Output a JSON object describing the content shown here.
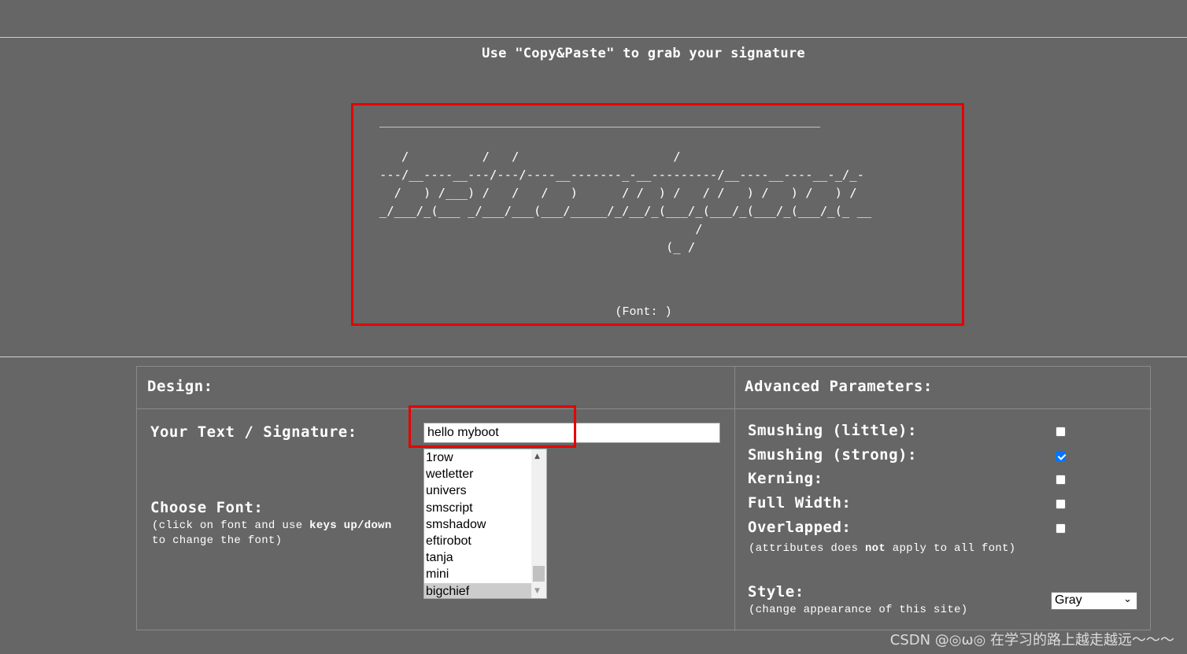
{
  "header": {
    "instruction": "Use \"Copy&Paste\" to grab your signature"
  },
  "output": {
    "ascii_lines": [
      "____________________________________________________________",
      "",
      "   /          /   /                     /",
      "---/__----__---/---/----__-------_-__---------/__----__----__-_/_-",
      "  /   ) /___) /   /   /   )      / /  ) /   / /   ) /   ) /   ) /",
      "_/___/_(___ _/___/___(___/_____/_/__/_(___/_(___/_(___/_(___/_(_ __",
      "                                           /",
      "                                       (_ /"
    ],
    "font_caption": "(Font: )"
  },
  "design": {
    "heading": "Design:",
    "text_label": "Your Text / Signature:",
    "text_value": "hello myboot",
    "font_label": "Choose Font:",
    "font_hint_pre": "(click on font and use ",
    "font_hint_keys": "keys up/down",
    "font_hint_line2": "to change the font)",
    "fonts": [
      "1row",
      "wetletter",
      "univers",
      "smscript",
      "smshadow",
      "eftirobot",
      "tanja",
      "mini",
      "bigchief"
    ],
    "selected_font": "bigchief",
    "scroll_up_icon": "▲",
    "scroll_down_icon": "▼"
  },
  "advanced": {
    "heading": "Advanced Parameters:",
    "params": [
      {
        "label": "Smushing (little):",
        "checked": false
      },
      {
        "label": "Smushing (strong):",
        "checked": true
      },
      {
        "label": "Kerning:",
        "checked": false
      },
      {
        "label": "Full Width:",
        "checked": false
      },
      {
        "label": "Overlapped:",
        "checked": false
      }
    ],
    "note_pre": "(attributes does ",
    "note_bold": "not",
    "note_post": " apply to all font)",
    "style_label": "Style:",
    "style_hint": "(change appearance of this site)",
    "style_value": "Gray",
    "style_chevron": "⌄"
  },
  "watermark": "CSDN @◎ω◎ 在学习的路上越走越远～～～",
  "colors": {
    "background": "#666666",
    "highlight": "#e60000",
    "checkbox_checked": "#0075ff"
  }
}
